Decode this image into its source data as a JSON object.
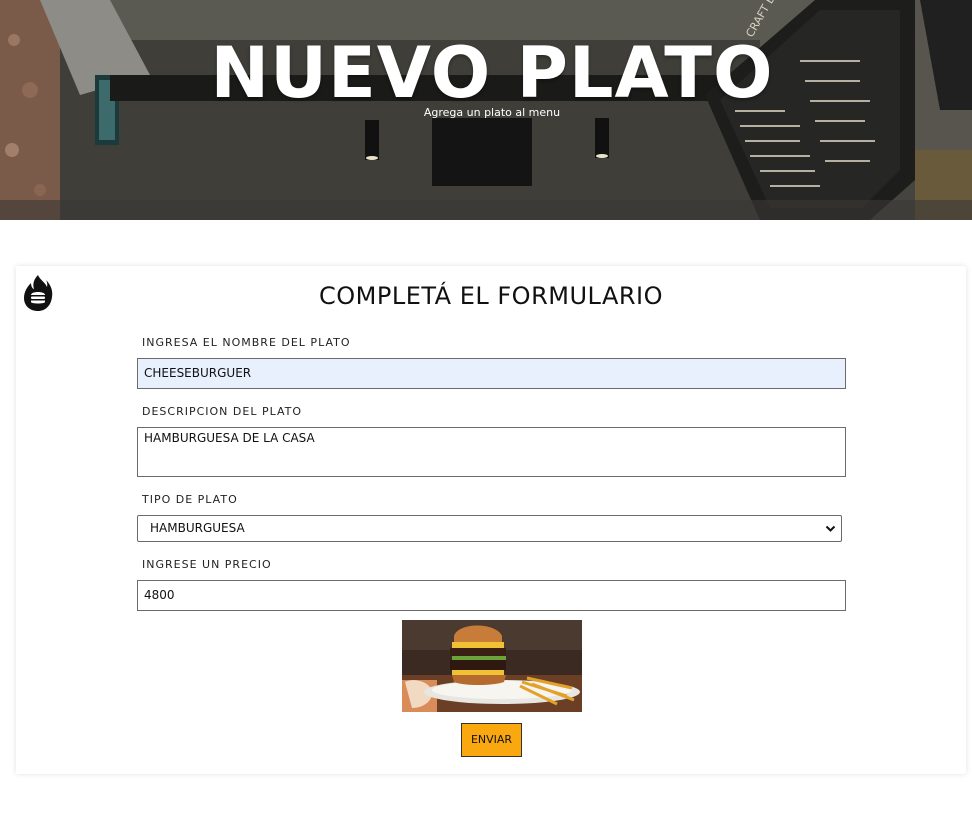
{
  "hero": {
    "title": "NUEVO PLATO",
    "subtitle": "Agrega un plato al menu",
    "signage_text": "CRAFT BEER"
  },
  "form": {
    "heading": "COMPLETÁ EL FORMULARIO",
    "logo_icon": "burger-flame-logo-icon",
    "name_label": "INGRESA EL NOMBRE DEL PLATO",
    "name_value": "CHEESEBURGUER",
    "description_label": "DESCRIPCION DEL PLATO",
    "description_value": "HAMBURGUESA DE LA CASA",
    "type_label": "TIPO DE PLATO",
    "type_selected": "HAMBURGUESA",
    "price_label": "INGRESE UN PRECIO",
    "price_value": "4800",
    "submit_label": "ENVIAR"
  },
  "colors": {
    "autofill_background": "#e8f0fe",
    "submit_background": "#f9a80f",
    "title_text": "#ffffff"
  }
}
